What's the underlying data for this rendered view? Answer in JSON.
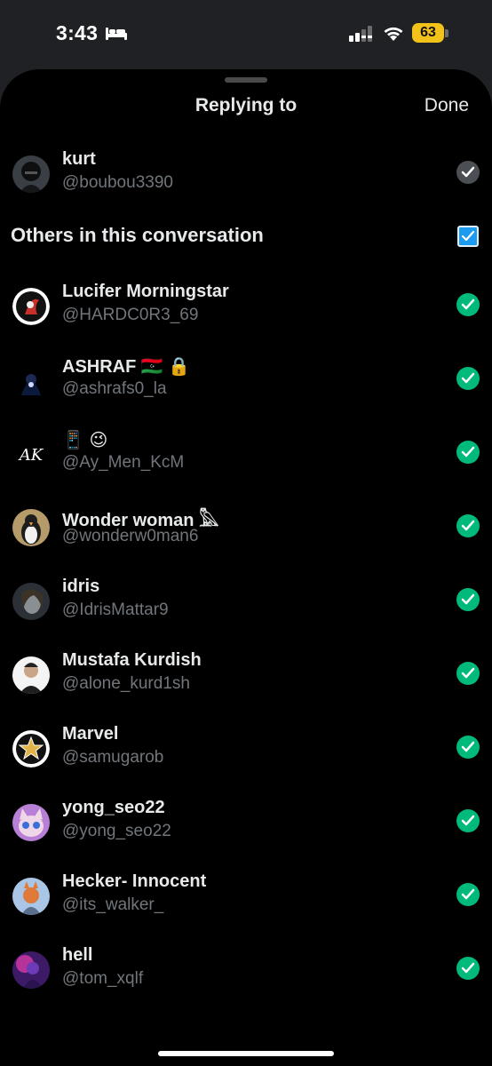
{
  "status_bar": {
    "time": "3:43",
    "battery": "63",
    "icons": [
      "bed-icon",
      "cellular-signal-icon",
      "wifi-icon",
      "battery-icon"
    ]
  },
  "sheet": {
    "title": "Replying to",
    "done_label": "Done"
  },
  "primary_user": {
    "name": "kurt",
    "handle": "@boubou3390",
    "checked": true
  },
  "others": {
    "header": "Others in this conversation",
    "all_selected": true,
    "users": [
      {
        "name": "Lucifer Morningstar",
        "handle": "@HARDC0R3_69",
        "checked": true
      },
      {
        "name": "ASHRAF 🇱🇾 🔒",
        "handle": "@ashrafs0_la",
        "checked": true
      },
      {
        "name": " 📱 😉",
        "handle": "@Ay_Men_KcM",
        "checked": true
      },
      {
        "name": "Wonder woman 𓅓",
        "handle": "@wonderw0man6",
        "checked": true
      },
      {
        "name": "idris",
        "handle": "@IdrisMattar9",
        "checked": true
      },
      {
        "name": "Mustafa Kurdish",
        "handle": "@alone_kurd1sh",
        "checked": true
      },
      {
        "name": "Marvel",
        "handle": "@samugarob",
        "checked": true
      },
      {
        "name": "yong_seo22",
        "handle": "@yong_seo22",
        "checked": true
      },
      {
        "name": "Hecker- Innocent",
        "handle": "@its_walker_",
        "checked": true
      },
      {
        "name": "hell",
        "handle": "@tom_xqlf",
        "checked": true
      }
    ]
  },
  "colors": {
    "accent_blue": "#1d9bf0",
    "check_green": "#00ba7c",
    "secondary_text": "#71767b",
    "background": "#000000"
  }
}
